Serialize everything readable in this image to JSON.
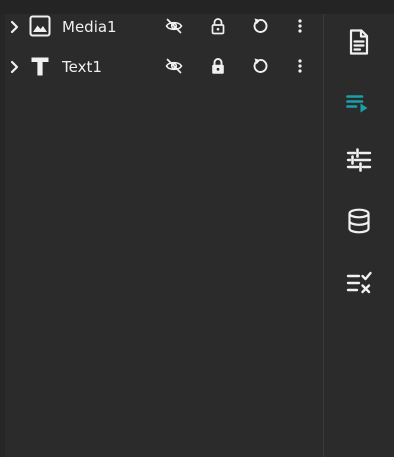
{
  "layers": [
    {
      "name": "Media1",
      "type_icon": "image-icon",
      "visibility_icon": "visibility-off-icon",
      "lock_icon": "lock-open-icon",
      "reset_icon": "reset-icon",
      "more_icon": "more-vertical-icon",
      "locked": false
    },
    {
      "name": "Text1",
      "type_icon": "text-icon",
      "visibility_icon": "visibility-off-icon",
      "lock_icon": "lock-icon",
      "reset_icon": "reset-icon",
      "more_icon": "more-vertical-icon",
      "locked": true
    }
  ],
  "sidebar": {
    "items": [
      {
        "icon": "document-icon",
        "active": false
      },
      {
        "icon": "layers-play-icon",
        "active": true
      },
      {
        "icon": "sliders-icon",
        "active": false
      },
      {
        "icon": "database-icon",
        "active": false
      },
      {
        "icon": "checklist-icon",
        "active": false
      }
    ]
  },
  "colors": {
    "background": "#2b2b2b",
    "text": "#f0f0f0",
    "accent": "#19a0a8",
    "divider": "#3a3a3a"
  }
}
